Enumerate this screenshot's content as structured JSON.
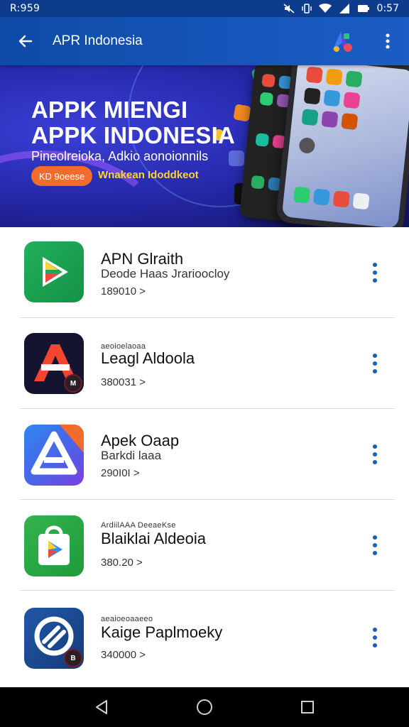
{
  "status_bar": {
    "left_text": "R:959",
    "time": "0:57",
    "icons": [
      "mute-icon",
      "vibrate-icon",
      "wifi-icon",
      "signal-icon",
      "battery-icon"
    ]
  },
  "app_bar": {
    "title": "APR Indonesia",
    "back_icon": "arrow-left-icon",
    "logo_icon": "brand-logo-icon",
    "menu_icon": "more-vertical-icon"
  },
  "banner": {
    "title_line1": "APPK MIENGI",
    "title_line2": "APPK INDONESIA",
    "subtitle": "Pineolreioka, Adkio aonoionnils",
    "badge": "KD 9oeese",
    "tagline": "Wnakean Idoddkeot"
  },
  "apps": [
    {
      "overline": "",
      "name": "APN Glraith",
      "desc": "Deode Haas Jrarioocloy",
      "size": "189010 >",
      "icon": "play-store-icon",
      "icon_colors": [
        "#1fa855",
        "#16924a"
      ]
    },
    {
      "overline": "aeoioelaoaa",
      "name": "Leagl Aldoola",
      "desc": "",
      "size": "380031 >",
      "icon": "letter-a-icon",
      "icon_colors": [
        "#161632",
        "#0f0f26"
      ],
      "badge": "M"
    },
    {
      "overline": "",
      "name": "Apek Oaap",
      "desc": "Barkdi laaa",
      "size": "290I0I >",
      "icon": "triangle-a-icon",
      "icon_colors": [
        "#2f7de8",
        "#6a45e6"
      ]
    },
    {
      "overline": "ArdiilAAA DeeaeKse",
      "name": "Blaiklai Aldeoia",
      "desc": "",
      "size": "380.20 >",
      "icon": "shopping-bag-play-icon",
      "icon_colors": [
        "#2fae4a",
        "#1f9a3c"
      ]
    },
    {
      "overline": "aeaioeoaaeeo",
      "name": "Kaige Paplmoeky",
      "desc": "",
      "size": "340000 >",
      "icon": "circle-swirl-icon",
      "icon_colors": [
        "#1e4f9a",
        "#163d7c"
      ],
      "badge": "B"
    }
  ],
  "nav_bar": {
    "icons": [
      "back-triangle-icon",
      "home-circle-icon",
      "recents-square-icon"
    ]
  },
  "colors": {
    "primary": "#1656bb",
    "banner_bg": "#2b2fb8",
    "accent_orange": "#f26c2b",
    "accent_yellow": "#ffd23a",
    "menu_dot": "#1a5fb4"
  }
}
